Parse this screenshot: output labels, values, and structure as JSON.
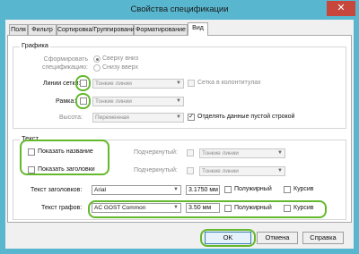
{
  "window": {
    "title": "Свойства спецификации",
    "close": "✕"
  },
  "tabs": [
    "Поля",
    "Фильтр",
    "Сортировка/Группирование",
    "Форматирование",
    "Вид"
  ],
  "graphics": {
    "legend": "Графика",
    "form_label": "Сформировать спецификацию:",
    "radio_top": "Сверху вниз",
    "radio_bottom": "Снизу вверх",
    "grid_label": "Линии сетки:",
    "grid_combo": "Тонкие линии",
    "footer_grid": "Сетка в колонтитулах",
    "frame_label": "Рамка:",
    "frame_combo": "Тонкие линии",
    "height_label": "Высота:",
    "height_combo": "Переменная",
    "separate_empty": "Отделять данные пустой строкой"
  },
  "text": {
    "legend": "Текст",
    "show_title": "Показать название",
    "underline_label": "Подчеркнутый:",
    "underline_combo": "Тонкие линии",
    "show_headers": "Показать заголовки",
    "underline_label2": "Подчеркнутый:",
    "underline_combo2": "Тонкие линии",
    "header_text_label": "Текст заголовков:",
    "header_font": "Arial",
    "header_size": "3.1750 мм",
    "bold": "Полужирный",
    "italic": "Курсив",
    "graph_text_label": "Текст графов:",
    "graph_font": "AC GOST Common",
    "graph_size": "3.50 мм",
    "bold2": "Полужирный",
    "italic2": "Курсив"
  },
  "buttons": {
    "ok": "OK",
    "cancel": "Отмена",
    "help": "Справка"
  },
  "colors": {
    "frame": "#58b7cf",
    "highlight": "#63b92c",
    "close": "#c7473d"
  }
}
